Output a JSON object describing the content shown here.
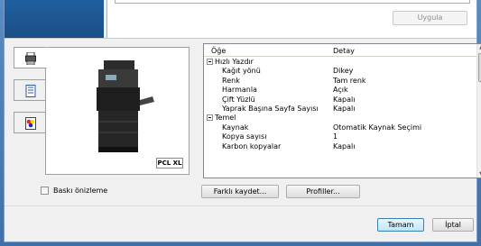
{
  "top": {
    "apply_button": "Uygula"
  },
  "tree": {
    "col_item": "Öğe",
    "col_detail": "Detay",
    "rows": [
      {
        "indent": 0,
        "group": true,
        "key": "Hızlı Yazdır",
        "value": ""
      },
      {
        "indent": 1,
        "group": false,
        "key": "Kağıt yönü",
        "value": "Dikey"
      },
      {
        "indent": 1,
        "group": false,
        "key": "Renk",
        "value": "Tam renk"
      },
      {
        "indent": 1,
        "group": false,
        "key": "Harmanla",
        "value": "Açık"
      },
      {
        "indent": 1,
        "group": false,
        "key": "Çift Yüzlü",
        "value": "Kapalı"
      },
      {
        "indent": 1,
        "group": false,
        "key": "Yaprak Başına Sayfa Sayısı",
        "value": "Kapalı"
      },
      {
        "indent": 0,
        "group": true,
        "key": "Temel",
        "value": ""
      },
      {
        "indent": 1,
        "group": false,
        "key": "Kaynak",
        "value": "Otomatik Kaynak Seçimi"
      },
      {
        "indent": 1,
        "group": false,
        "key": "Kopya sayısı",
        "value": "1"
      },
      {
        "indent": 1,
        "group": false,
        "key": "Karbon kopyalar",
        "value": "Kapalı"
      }
    ]
  },
  "preview": {
    "badge": "PCL XL"
  },
  "print_preview_label": "Baskı önizleme",
  "buttons": {
    "save_as": "Farklı kaydet...",
    "profiles": "Profiller...",
    "ok": "Tamam",
    "cancel": "İptal"
  },
  "colors": {
    "window_blue": "#3f70a8",
    "dark_blue_block": "#1b4f85",
    "default_button_border": "#3c7fb1"
  }
}
